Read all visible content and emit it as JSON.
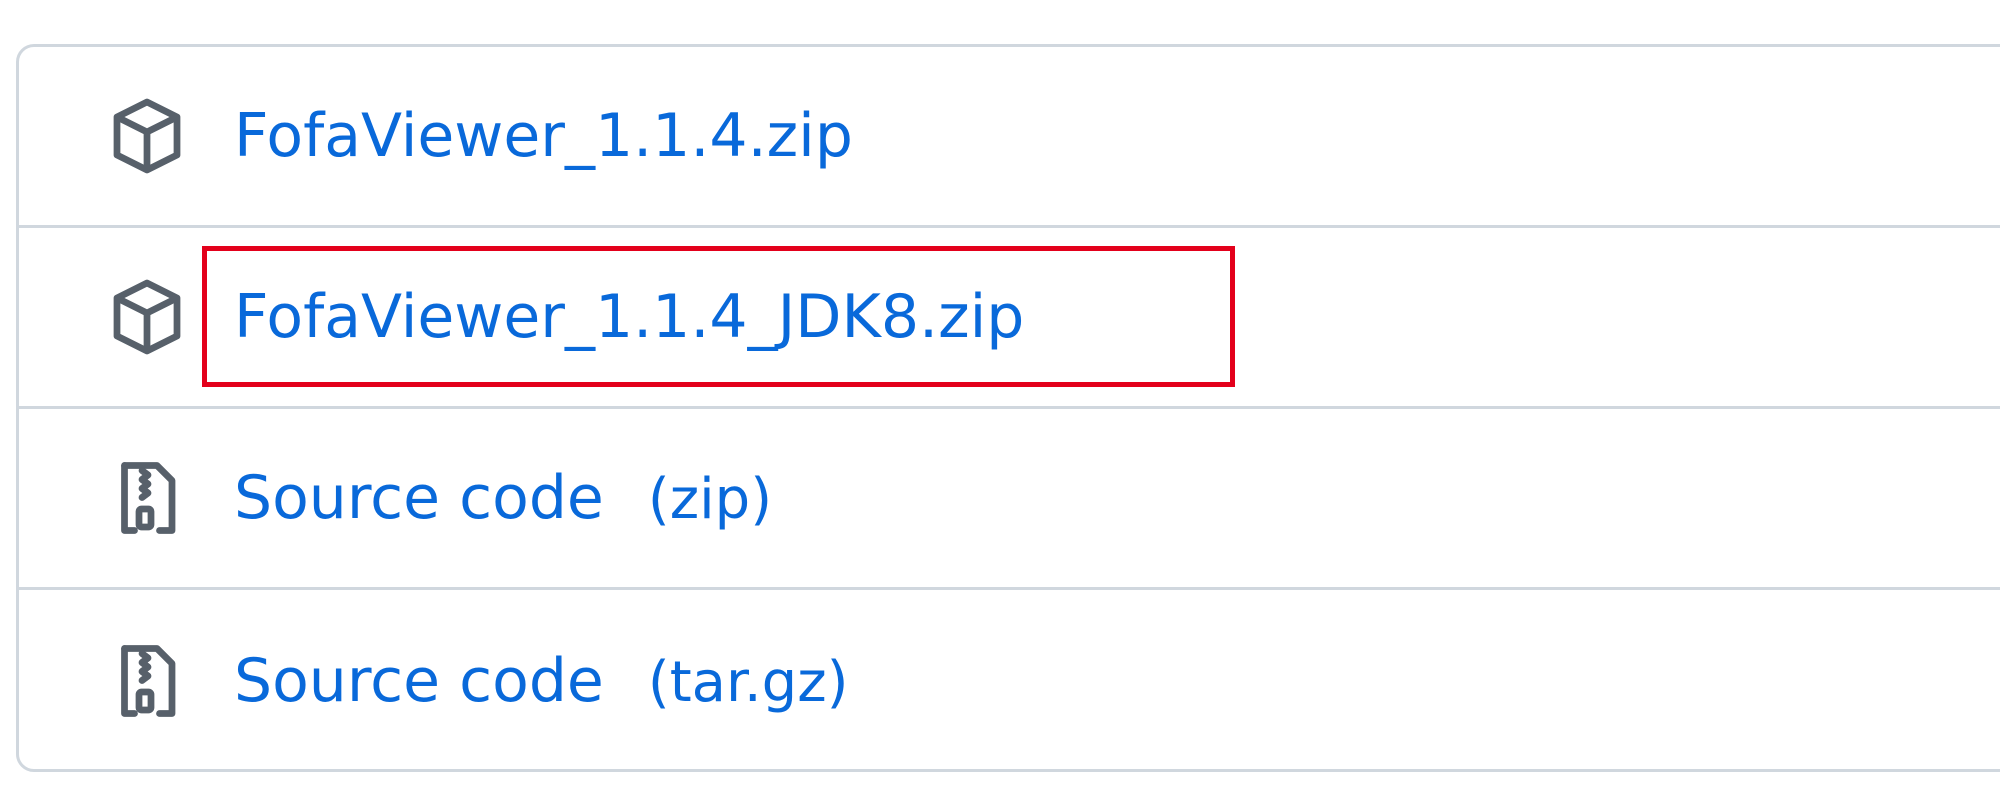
{
  "assets": [
    {
      "kind": "package",
      "icon": "package-icon",
      "label": "FofaViewer_1.1.4.zip",
      "suffix": ""
    },
    {
      "kind": "package",
      "icon": "package-icon",
      "label": "FofaViewer_1.1.4_JDK8.zip",
      "suffix": ""
    },
    {
      "kind": "source",
      "icon": "file-zip-icon",
      "label": "Source code",
      "suffix": "(zip)"
    },
    {
      "kind": "source",
      "icon": "file-zip-icon",
      "label": "Source code",
      "suffix": "(tar.gz)"
    }
  ],
  "highlight": {
    "target": "FofaViewer_1.1.4_JDK8.zip",
    "color": "#e3001b"
  },
  "colors": {
    "link": "#0969da",
    "icon": "#57606a",
    "border": "#d0d7de"
  }
}
